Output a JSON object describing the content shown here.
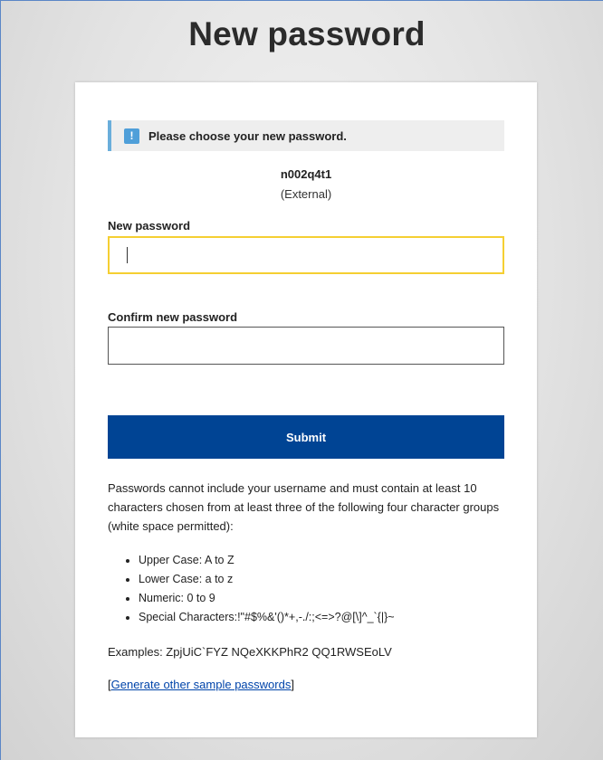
{
  "page": {
    "title": "New password"
  },
  "notice": {
    "icon": "exclamation-icon",
    "text": "Please choose your new password."
  },
  "user": {
    "username": "n002q4t1",
    "type": "(External)"
  },
  "form": {
    "new_password_label": "New password",
    "new_password_value": "",
    "confirm_password_label": "Confirm new password",
    "confirm_password_value": "",
    "submit_label": "Submit"
  },
  "rules": {
    "intro": "Passwords cannot include your username and must contain at least 10 characters chosen from at least three of the following four character groups (white space permitted):",
    "items": [
      "Upper Case: A to Z",
      "Lower Case: a to z",
      "Numeric: 0 to 9",
      "Special Characters:!\"#$%&'()*+,-./:;<=>?@[\\]^_`{|}~"
    ],
    "examples": "Examples: ZpjUiC`FYZ NQeXKKPhR2 QQ1RWSEoLV",
    "generate_open": "[",
    "generate_link": "Generate other sample passwords",
    "generate_close": "]"
  },
  "colors": {
    "submit_bg": "#004494",
    "focus_border": "#f5cf32",
    "notice_accent": "#6aaedb",
    "link": "#0044aa"
  }
}
